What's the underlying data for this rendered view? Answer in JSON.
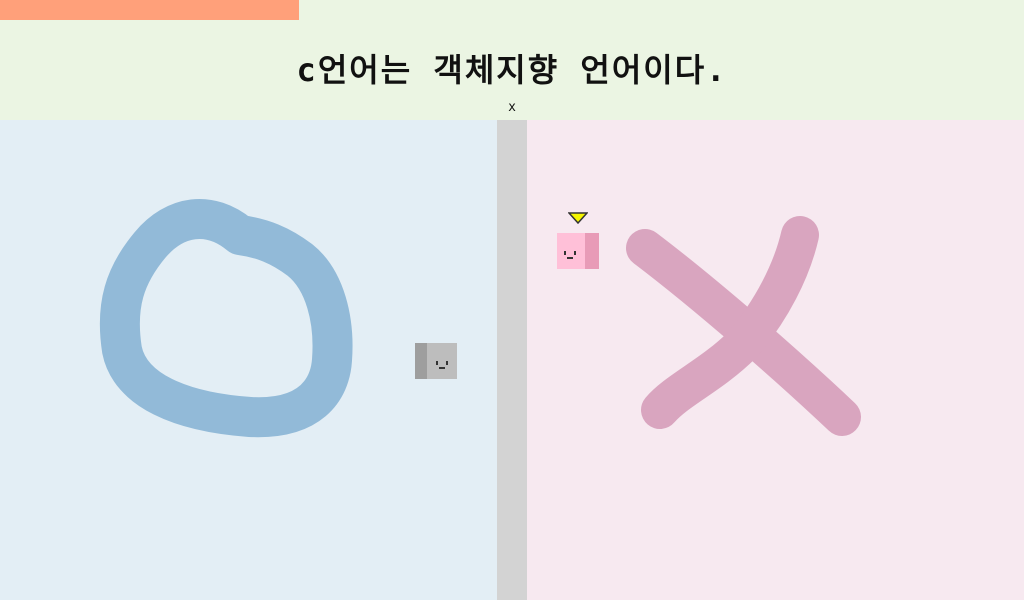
{
  "question": {
    "text": "c언어는 객체지향 언어이다."
  },
  "timer": {
    "label": "x",
    "remaining_fraction": 0.292,
    "bar_color": "#ffa07a"
  },
  "zones": {
    "o_color": "#e3eef5",
    "x_color": "#f7e9f0",
    "divider_color": "#d3d3d3",
    "o_mark_color": "#92bad8",
    "x_mark_color": "#d9a5bf"
  },
  "characters": {
    "player": {
      "color": "#ffc0d8",
      "pointer": "yellow-triangle"
    },
    "opponent": {
      "color": "#bdbdbd"
    }
  }
}
